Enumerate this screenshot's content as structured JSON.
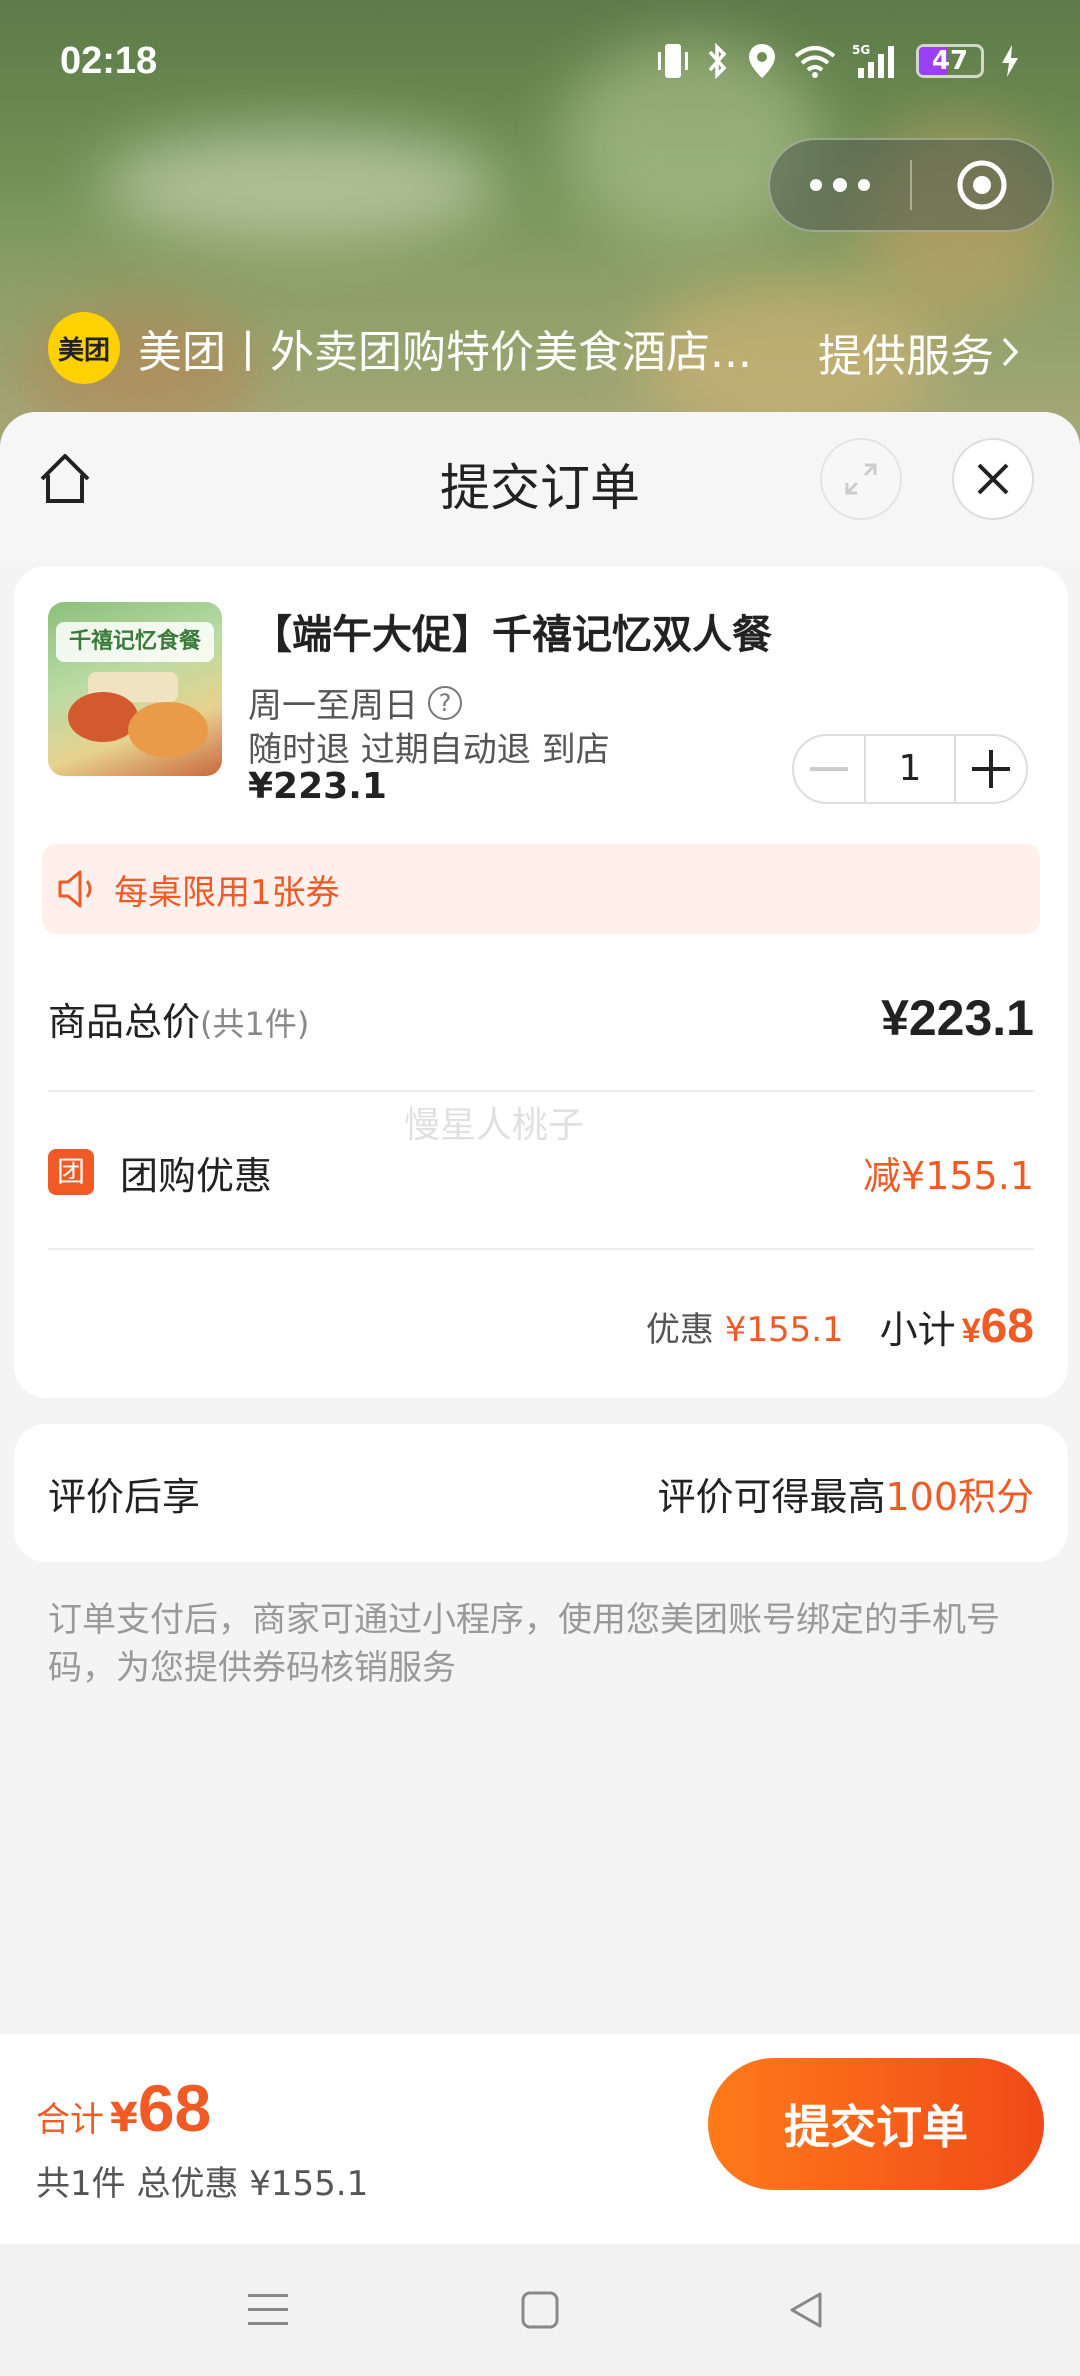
{
  "status_bar": {
    "time": "02:18",
    "battery": "47"
  },
  "mini_app": {
    "logo_text": "美团",
    "title": "美团丨外卖团购特价美食酒店...",
    "service_label": "提供服务"
  },
  "sheet": {
    "title": "提交订单"
  },
  "product": {
    "name": "【端午大促】千禧记忆双人餐",
    "image_caption": "千禧记忆食餐",
    "schedule": "周一至周日",
    "help_icon": "?",
    "refund_policy": "随时退 过期自动退 到店",
    "price": "¥223.1",
    "quantity": "1"
  },
  "notice": {
    "text": "每桌限用1张券"
  },
  "summary": {
    "total_label": "商品总价",
    "total_count": "(共1件)",
    "total_value": "¥223.1",
    "discount_badge": "团",
    "discount_label": "团购优惠",
    "discount_value": "减¥155.1",
    "watermark": "慢星人桃子",
    "subtotal_discount_label": "优惠",
    "subtotal_discount_value": "¥155.1",
    "subtotal_label": "小计",
    "subtotal_currency": "¥",
    "subtotal_value": "68"
  },
  "review": {
    "left": "评价后享",
    "right_prefix": "评价可得最高",
    "right_highlight": "100积分"
  },
  "note": "订单支付后，商家可通过小程序，使用您美团账号绑定的手机号码，为您提供券码核销服务",
  "bottom": {
    "sum_label": "合计",
    "sum_currency": "¥",
    "sum_value": "68",
    "sum_detail": "共1件 总优惠 ¥155.1",
    "submit_label": "提交订单"
  },
  "colors": {
    "accent": "#f05a24",
    "brand_yellow": "#ffd100"
  }
}
